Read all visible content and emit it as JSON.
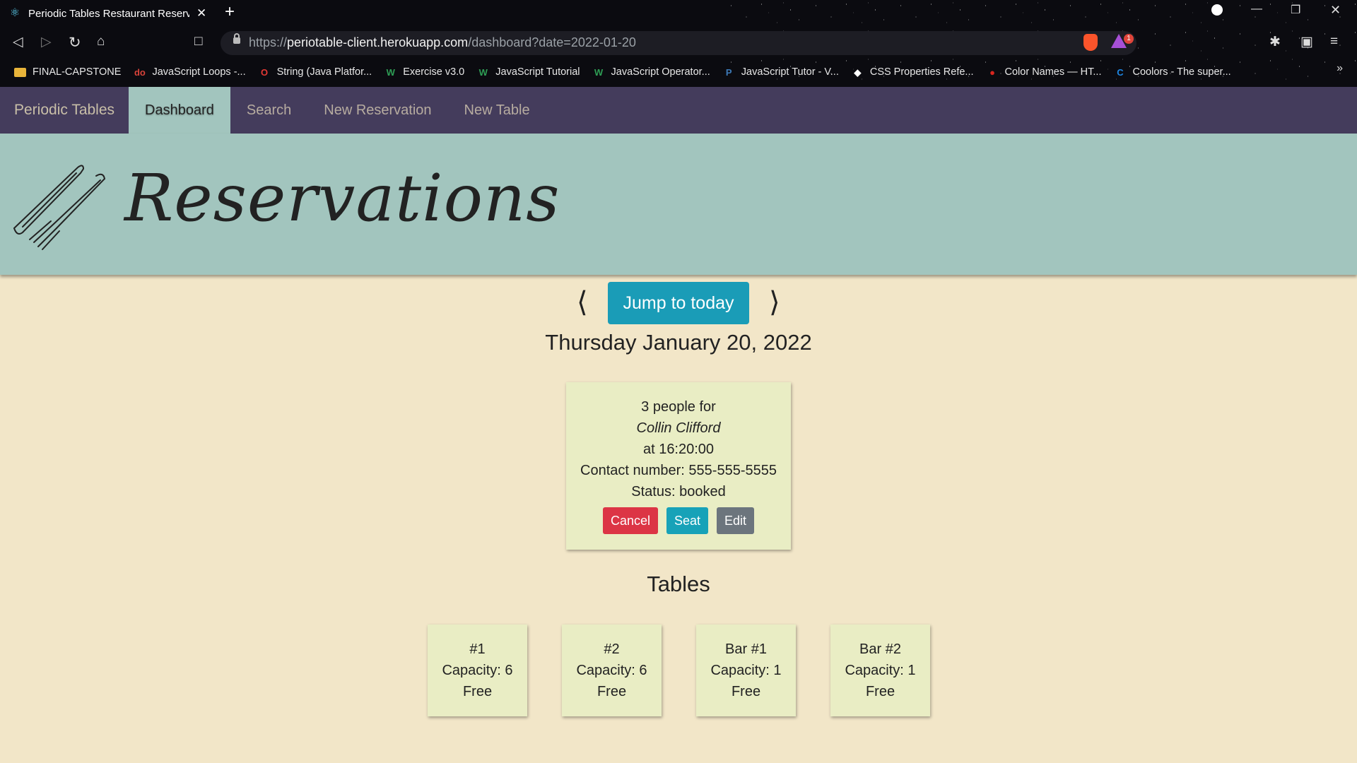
{
  "browser": {
    "tab_title": "Periodic Tables Restaurant Reserv",
    "url_scheme": "https://",
    "url_host": "periotable-client.herokuapp.com",
    "url_path": "/dashboard?date=2022-01-20",
    "bat_badge": "1",
    "bookmarks": [
      {
        "label": "FINAL-CAPSTONE",
        "icon": "folder-icon",
        "glyph": "",
        "color": "#e8b43a"
      },
      {
        "label": "JavaScript Loops -...",
        "icon": "do-logo-icon",
        "glyph": "do",
        "color": "#d9433a"
      },
      {
        "label": "String (Java Platfor...",
        "icon": "oracle-icon",
        "glyph": "O",
        "color": "#e53935"
      },
      {
        "label": "Exercise v3.0",
        "icon": "w3schools-icon",
        "glyph": "W",
        "color": "#2e9e55"
      },
      {
        "label": "JavaScript Tutorial",
        "icon": "w3schools-icon",
        "glyph": "W",
        "color": "#2e9e55"
      },
      {
        "label": "JavaScript Operator...",
        "icon": "w3schools-icon",
        "glyph": "W",
        "color": "#2e9e55"
      },
      {
        "label": "JavaScript Tutor - V...",
        "icon": "python-icon",
        "glyph": "P",
        "color": "#3d7ab8"
      },
      {
        "label": "CSS Properties Refe...",
        "icon": "ref-icon",
        "glyph": "◆",
        "color": "#ffffff"
      },
      {
        "label": "Color Names — HT...",
        "icon": "color-names-icon",
        "glyph": "●",
        "color": "#d8261f"
      },
      {
        "label": "Coolors - The super...",
        "icon": "coolors-icon",
        "glyph": "C",
        "color": "#1e88e5"
      }
    ]
  },
  "nav": {
    "brand": "Periodic Tables",
    "links": [
      "Dashboard",
      "Search",
      "New Reservation",
      "New Table"
    ]
  },
  "header": {
    "title": "Reservations"
  },
  "dashboard": {
    "prev_label": "⟨",
    "next_label": "⟩",
    "jump_label": "Jump to today",
    "date_label": "Thursday January 20, 2022"
  },
  "reservation": {
    "people": "3 people for",
    "name": "Collin Clifford",
    "time": "at 16:20:00",
    "contact": "Contact number: 555-555-5555",
    "status": "Status: booked",
    "cancel_label": "Cancel",
    "seat_label": "Seat",
    "edit_label": "Edit"
  },
  "tables_heading": "Tables",
  "tables": [
    {
      "name": "#1",
      "capacity": "Capacity: 6",
      "status": "Free"
    },
    {
      "name": "#2",
      "capacity": "Capacity: 6",
      "status": "Free"
    },
    {
      "name": "Bar #1",
      "capacity": "Capacity: 1",
      "status": "Free"
    },
    {
      "name": "Bar #2",
      "capacity": "Capacity: 1",
      "status": "Free"
    }
  ]
}
